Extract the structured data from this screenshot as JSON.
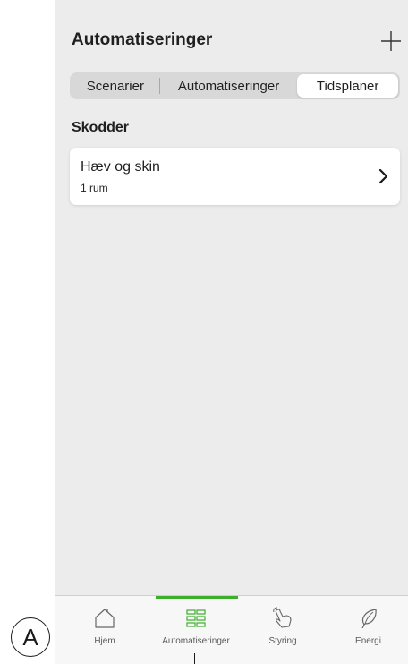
{
  "header": {
    "title": "Automatiseringer",
    "add_icon": "plus-icon"
  },
  "segments": [
    {
      "label": "Scenarier",
      "selected": false
    },
    {
      "label": "Automatiseringer",
      "selected": false
    },
    {
      "label": "Tidsplaner",
      "selected": true
    }
  ],
  "section": {
    "title": "Skodder"
  },
  "schedules": [
    {
      "title": "Hæv og skin",
      "subtitle": "1 rum",
      "icon": "chevron-right-icon"
    }
  ],
  "tabbar": {
    "active": "Automatiseringer",
    "accent_color": "#3dae2b",
    "items": [
      {
        "label": "Hjem",
        "icon": "home-icon"
      },
      {
        "label": "Automatiseringer",
        "icon": "grid-icon"
      },
      {
        "label": "Styring",
        "icon": "hand-icon"
      },
      {
        "label": "Energi",
        "icon": "leaf-icon"
      }
    ]
  },
  "annotation": {
    "callout_label": "A"
  }
}
